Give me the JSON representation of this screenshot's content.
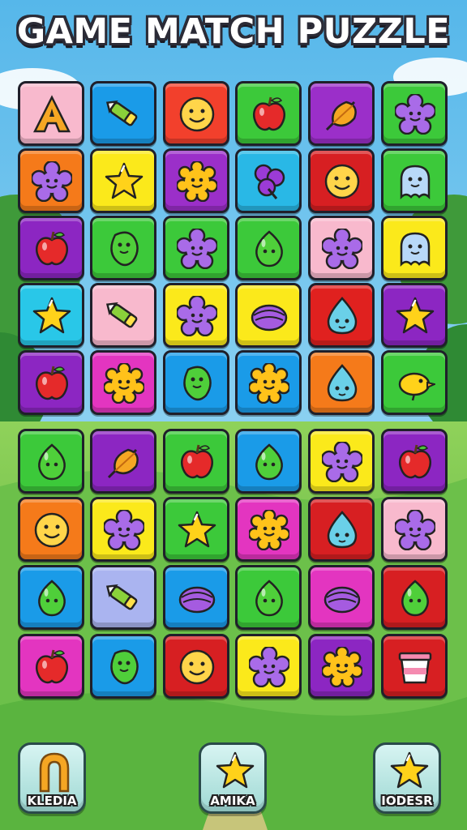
{
  "title": "GAME MATCH PUZZLE",
  "board": {
    "rows": [
      [
        {
          "color": "#f8b9cd",
          "icon": "letter-a-icon"
        },
        {
          "color": "#1a9be8",
          "icon": "crayon-icon"
        },
        {
          "color": "#f2402c",
          "icon": "smiley-face-icon"
        },
        {
          "color": "#3cc93a",
          "icon": "apple-icon"
        },
        {
          "color": "#9b2fc9",
          "icon": "leaf-icon"
        },
        {
          "color": "#3cc93a",
          "icon": "flower-face-icon"
        }
      ],
      [
        {
          "color": "#f57a1a",
          "icon": "flower-face-icon"
        },
        {
          "color": "#fbe91b",
          "icon": "star-icon"
        },
        {
          "color": "#9b2fc9",
          "icon": "sun-face-icon"
        },
        {
          "color": "#29b8e6",
          "icon": "clover-icon"
        },
        {
          "color": "#d71f22",
          "icon": "smiley-face-icon"
        },
        {
          "color": "#3cc93a",
          "icon": "ghost-blob-icon"
        }
      ],
      [
        {
          "color": "#8c26c2",
          "icon": "apple-icon"
        },
        {
          "color": "#3cc93a",
          "icon": "bean-face-icon"
        },
        {
          "color": "#3cc93a",
          "icon": "flower-face-icon"
        },
        {
          "color": "#3cc93a",
          "icon": "leaf-drop-icon"
        },
        {
          "color": "#f8b9cd",
          "icon": "flower-face-icon"
        },
        {
          "color": "#fbe91b",
          "icon": "ghost-blob-icon"
        }
      ],
      [
        {
          "color": "#29c7e8",
          "icon": "star-icon"
        },
        {
          "color": "#f8b9cd",
          "icon": "crayon-icon"
        },
        {
          "color": "#fbe91b",
          "icon": "flower-face-icon"
        },
        {
          "color": "#fbe91b",
          "icon": "shell-icon"
        },
        {
          "color": "#e0211f",
          "icon": "droplet-face-icon"
        },
        {
          "color": "#8c26c2",
          "icon": "star-icon"
        }
      ],
      [
        {
          "color": "#8c26c2",
          "icon": "apple-icon"
        },
        {
          "color": "#e335c0",
          "icon": "sun-face-icon"
        },
        {
          "color": "#1a9be8",
          "icon": "bean-face-icon"
        },
        {
          "color": "#1a9be8",
          "icon": "sun-face-icon"
        },
        {
          "color": "#f57a1a",
          "icon": "droplet-face-icon"
        },
        {
          "color": "#3cc93a",
          "icon": "bird-icon"
        }
      ],
      [
        {
          "color": "#3cc93a",
          "icon": "leaf-drop-icon"
        },
        {
          "color": "#8c26c2",
          "icon": "leaf-icon"
        },
        {
          "color": "#3cc93a",
          "icon": "apple-icon"
        },
        {
          "color": "#1a9be8",
          "icon": "leaf-drop-icon"
        },
        {
          "color": "#fbe91b",
          "icon": "flower-face-icon"
        },
        {
          "color": "#8c26c2",
          "icon": "apple-icon"
        }
      ],
      [
        {
          "color": "#f57a1a",
          "icon": "smiley-face-icon"
        },
        {
          "color": "#fbe91b",
          "icon": "flower-face-icon"
        },
        {
          "color": "#3cc93a",
          "icon": "star-icon"
        },
        {
          "color": "#e335c0",
          "icon": "sun-face-icon"
        },
        {
          "color": "#d71f22",
          "icon": "droplet-face-icon"
        },
        {
          "color": "#f8b9cd",
          "icon": "flower-face-icon"
        }
      ],
      [
        {
          "color": "#1a9be8",
          "icon": "leaf-drop-icon"
        },
        {
          "color": "#aab4f0",
          "icon": "crayon-icon"
        },
        {
          "color": "#1a9be8",
          "icon": "shell-icon"
        },
        {
          "color": "#3cc93a",
          "icon": "leaf-drop-icon"
        },
        {
          "color": "#e335c0",
          "icon": "shell-icon"
        },
        {
          "color": "#d71f22",
          "icon": "leaf-drop-icon"
        }
      ],
      [
        {
          "color": "#e335c0",
          "icon": "apple-icon"
        },
        {
          "color": "#1a9be8",
          "icon": "bean-face-icon"
        },
        {
          "color": "#d71f22",
          "icon": "smiley-face-icon"
        },
        {
          "color": "#fbe91b",
          "icon": "flower-face-icon"
        },
        {
          "color": "#8c26c2",
          "icon": "sun-face-icon"
        },
        {
          "color": "#d71f22",
          "icon": "cup-icon"
        }
      ]
    ]
  },
  "buttons": [
    {
      "label": "KLEDIA",
      "icon": "magnet-icon"
    },
    {
      "label": "AMIKA",
      "icon": "star-icon"
    },
    {
      "label": "IODESR",
      "icon": "star-icon"
    }
  ]
}
